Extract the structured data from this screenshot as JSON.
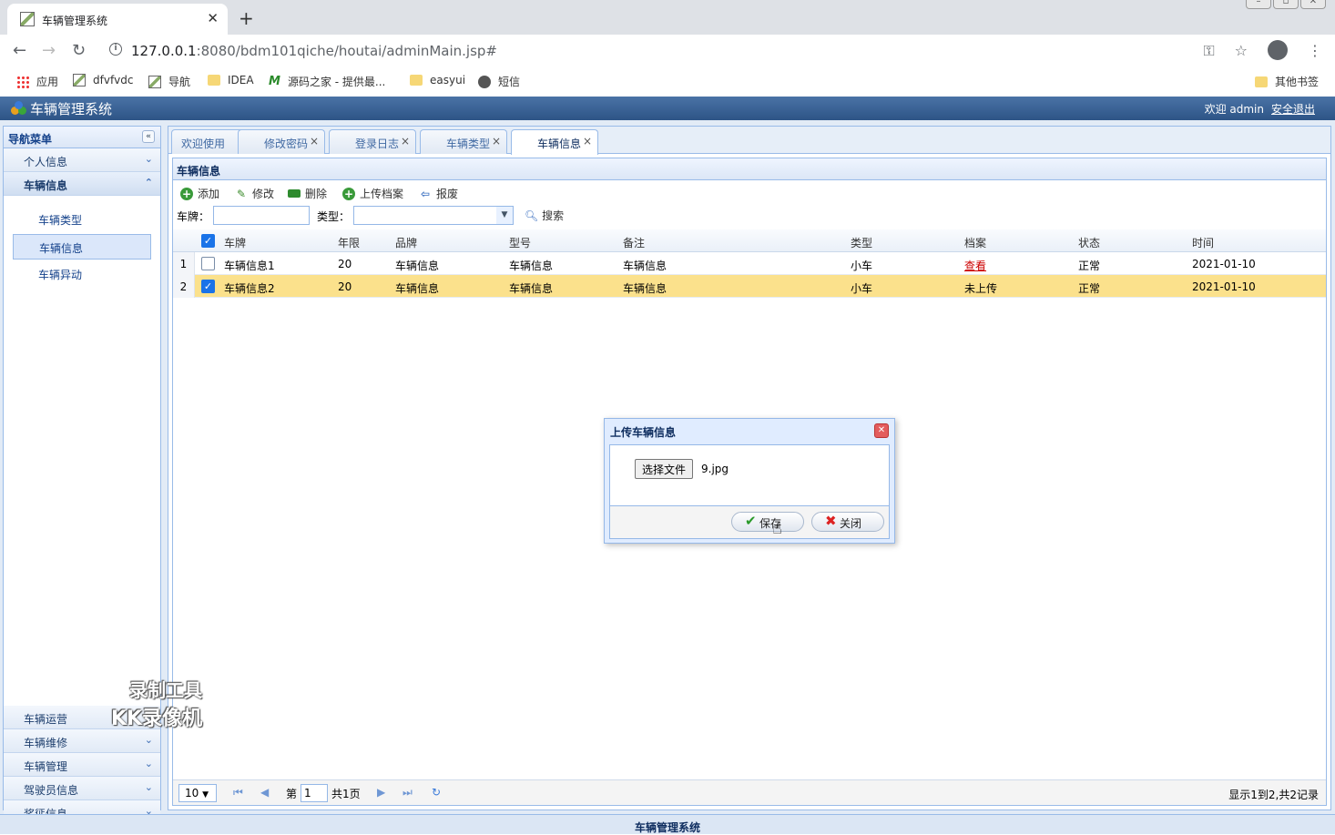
{
  "browser": {
    "tab_title": "车辆管理系统",
    "url_host": "127.0.0.1",
    "url_rest": ":8080/bdm101qiche/houtai/adminMain.jsp#",
    "bookmarks": [
      "应用",
      "dfvfvdc",
      "导航",
      "IDEA",
      "源码之家 - 提供最...",
      "easyui",
      "短信"
    ],
    "other_bookmarks": "其他书签"
  },
  "app": {
    "title": "车辆管理系统",
    "welcome": "欢迎 admin",
    "logout": "安全退出"
  },
  "sidebar": {
    "title": "导航菜单",
    "sections_top": [
      "个人信息",
      "车辆信息"
    ],
    "items": [
      "车辆类型",
      "车辆信息",
      "车辆异动"
    ],
    "selected_item": "车辆信息",
    "sections_bottom": [
      "车辆运营",
      "车辆维修",
      "车辆管理",
      "驾驶员信息",
      "奖惩信息"
    ]
  },
  "tabs": [
    {
      "label": "欢迎使用",
      "closable": false
    },
    {
      "label": "修改密码",
      "closable": true
    },
    {
      "label": "登录日志",
      "closable": true
    },
    {
      "label": "车辆类型",
      "closable": true
    },
    {
      "label": "车辆信息",
      "closable": true,
      "active": true
    }
  ],
  "panel": {
    "title": "车辆信息",
    "toolbar": {
      "add": "添加",
      "edit": "修改",
      "delete": "删除",
      "upload": "上传档案",
      "scrap": "报废"
    },
    "search": {
      "plate_label": "车牌：",
      "type_label": "类型：",
      "button": "搜索"
    }
  },
  "grid": {
    "columns": [
      "车牌",
      "年限",
      "品牌",
      "型号",
      "备注",
      "类型",
      "档案",
      "状态",
      "时间"
    ],
    "rows": [
      {
        "num": "1",
        "checked": false,
        "cells": [
          "车辆信息1",
          "20",
          "车辆信息",
          "车辆信息",
          "车辆信息",
          "小车",
          "查看",
          "正常",
          "2021-01-10"
        ]
      },
      {
        "num": "2",
        "checked": true,
        "cells": [
          "车辆信息2",
          "20",
          "车辆信息",
          "车辆信息",
          "车辆信息",
          "小车",
          "未上传",
          "正常",
          "2021-01-10"
        ]
      }
    ]
  },
  "pager": {
    "page_size": "10",
    "page_prefix": "第",
    "page_value": "1",
    "page_total": "共1页",
    "info": "显示1到2,共2记录"
  },
  "dialog": {
    "title": "上传车辆信息",
    "file_button": "选择文件",
    "file_name": "9.jpg",
    "save": "保存",
    "close": "关闭"
  },
  "footer": "车辆管理系统",
  "watermark": {
    "line1": "录制工具",
    "line2": "KK录像机"
  },
  "colors": {
    "header": "#2d5486",
    "selected_row": "#fbe18c",
    "link": "#c00"
  }
}
